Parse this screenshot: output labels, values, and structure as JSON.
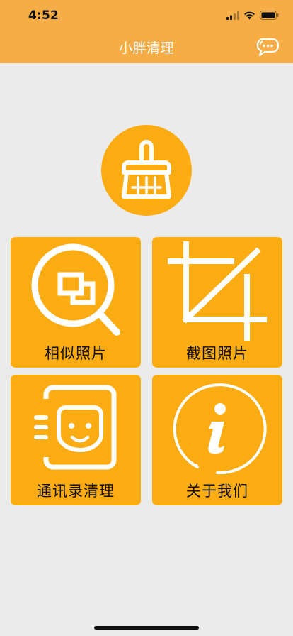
{
  "status_bar": {
    "time": "4:52"
  },
  "nav": {
    "title": "小胖清理",
    "chat_icon": "chat-bubble-icon"
  },
  "logo": {
    "icon": "broom-icon"
  },
  "tiles": [
    {
      "label": "相似照片",
      "icon": "similar-photos-icon"
    },
    {
      "label": "截图照片",
      "icon": "crop-icon"
    },
    {
      "label": "通讯录清理",
      "icon": "face-scan-icon"
    },
    {
      "label": "关于我们",
      "icon": "info-icon"
    }
  ],
  "colors": {
    "nav_background": "#f6ad45",
    "accent": "#fbac12",
    "background": "#ebebeb"
  }
}
